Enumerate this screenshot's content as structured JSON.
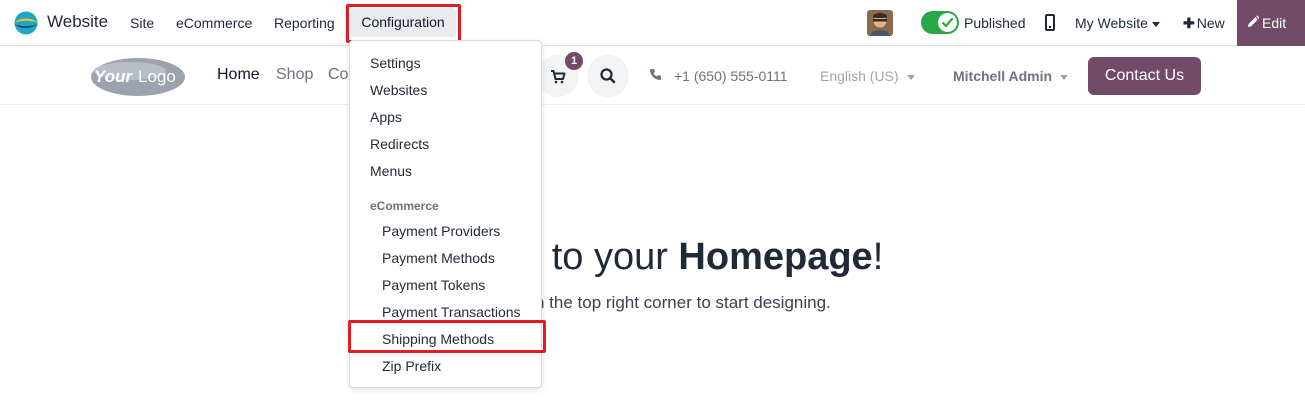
{
  "topbar": {
    "app_name": "Website",
    "menu": [
      "Site",
      "eCommerce",
      "Reporting",
      "Configuration"
    ],
    "published_label": "Published",
    "my_website_label": "My Website",
    "new_label": "New",
    "edit_label": "Edit",
    "accent_color": "#714b67",
    "toggle_color": "#28a745"
  },
  "site_header": {
    "logo_text": "YourLogo",
    "nav": [
      "Home",
      "Shop",
      "Co"
    ],
    "cart_count": "1",
    "phone": "+1 (650) 555-0111",
    "language": "English (US)",
    "user": "Mitchell Admin",
    "contact_button": "Contact Us"
  },
  "hero": {
    "title_prefix": "e to your ",
    "title_bold": "Homepage",
    "title_suffix": "!",
    "subtitle": "n the top right corner to start designing."
  },
  "dropdown": {
    "items": [
      "Settings",
      "Websites",
      "Apps",
      "Redirects",
      "Menus"
    ],
    "section_header": "eCommerce",
    "ecommerce_items": [
      "Payment Providers",
      "Payment Methods",
      "Payment Tokens",
      "Payment Transactions",
      "Shipping Methods",
      "Zip Prefix"
    ],
    "highlighted_item": "Shipping Methods"
  },
  "highlight_color": "#e01b24"
}
